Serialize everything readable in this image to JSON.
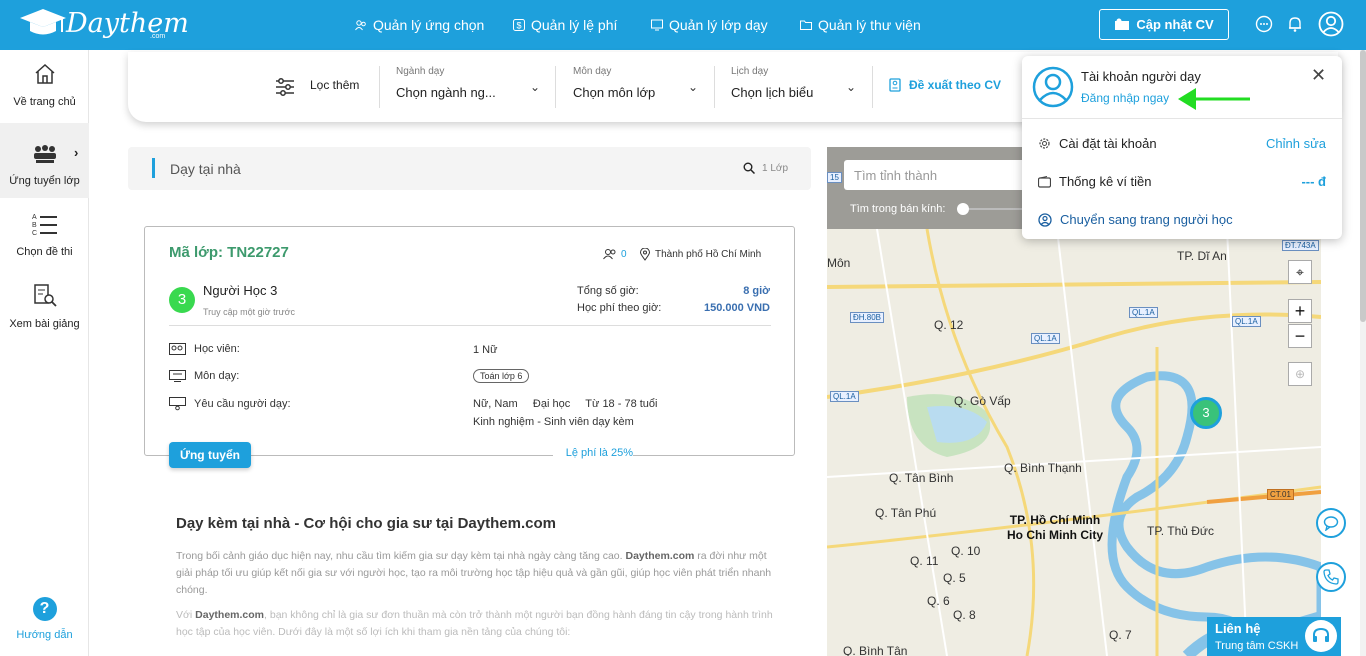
{
  "brand": {
    "name": "Daythem",
    "suffix": ".com"
  },
  "nav": {
    "items": [
      {
        "label": "Quản lý ứng chọn",
        "icon": "users-icon"
      },
      {
        "label": "Quản lý lệ phí",
        "icon": "dollar-icon"
      },
      {
        "label": "Quản lý lớp dạy",
        "icon": "class-icon"
      },
      {
        "label": "Quản lý thư viện",
        "icon": "folder-icon"
      }
    ],
    "cv_button": "Cập nhật CV"
  },
  "sidebar": {
    "items": [
      {
        "label": "Về trang chủ",
        "icon": "home-icon"
      },
      {
        "label": "Ứng tuyển lớp",
        "icon": "classroom-icon"
      },
      {
        "label": "Chọn đề thi",
        "icon": "list-icon"
      },
      {
        "label": "Xem bài giảng",
        "icon": "document-search-icon"
      }
    ],
    "help": {
      "label": "Hướng dẫn",
      "icon": "?"
    }
  },
  "filter": {
    "more_label": "Lọc thêm",
    "major": {
      "label": "Ngành dạy",
      "value": "Chọn ngành ng..."
    },
    "subject": {
      "label": "Môn dạy",
      "value": "Chọn môn lớp"
    },
    "schedule": {
      "label": "Lịch dạy",
      "value": "Chọn lịch biểu"
    },
    "suggest": "Đề xuất theo CV"
  },
  "listing": {
    "title": "Dạy tại nhà",
    "count": "1 Lớp"
  },
  "card": {
    "code": "Mã lớp: TN22727",
    "applicants": "0",
    "city": "Thành phố Hồ Chí Minh",
    "learner_initial": "3",
    "learner_name": "Người Học 3",
    "learner_sub": "Truy cập một giờ trước",
    "total_hours_label": "Tổng số giờ:",
    "total_hours": "8 giờ",
    "fee_label": "Học phí theo giờ:",
    "fee": "150.000 VND",
    "rows": [
      {
        "label": "Học viên:",
        "value": "1 Nữ"
      },
      {
        "label": "Môn dạy:",
        "value": "Toán lớp 6"
      },
      {
        "label": "Yêu cầu người dạy:",
        "value": "Nữ, Nam     Đại học     Từ 18 - 78 tuổi",
        "value2": "Kinh nghiệm - Sinh viên dạy kèm"
      }
    ],
    "apply": "Ứng tuyển",
    "commission": "Lệ phí là 25%"
  },
  "article": {
    "title": "Dạy kèm tại nhà - Cơ hội cho gia sư tại Daythem.com",
    "p1a": "Trong bối cảnh giáo dục hiện nay, nhu cầu tìm kiếm gia sư dạy kèm tại nhà ngày càng tăng cao.",
    "p1b": "Daythem.com",
    "p1c": "ra đời như một giải pháp tối ưu giúp kết nối gia sư với người học, tạo ra môi trường học tập hiệu quả và gần gũi, giúp học viên phát triển nhanh chóng.",
    "p2a": "Với",
    "p2b": "Daythem.com",
    "p2c": ", bạn không chỉ là gia sư đơn thuần mà còn trở thành một người bạn đồng hành đáng tin cậy trong hành trình học tập của học viên. Dưới đây là một số lợi ích khi tham gia nền tảng của chúng tôi:"
  },
  "map": {
    "search_placeholder": "Tìm tỉnh thành",
    "radius_label": "Tìm trong bán kính:",
    "labels": [
      "Q. 12",
      "Q. Gò Vấp",
      "Q. Bình Thạnh",
      "Q. Tân Bình",
      "Q. Tân Phú",
      "Q. 10",
      "Q. 11",
      "Q. 5",
      "Q. 6",
      "Q. 8",
      "Q. Bình Tân",
      "Q. 7",
      "TP. Dĩ An",
      "TP. Thủ Đức",
      "Môn"
    ],
    "city_label": "TP. Hồ Chí Minh",
    "city_label_en": "Ho Chi Minh City",
    "cluster": "3",
    "roads": [
      "QL.1A",
      "QL.1A",
      "QL.1A",
      "ĐH.80B",
      "QL.1A",
      "ĐT.743A",
      "CT.01",
      "15"
    ]
  },
  "popup": {
    "title": "Tài khoản người dạy",
    "login": "Đăng nhập ngay",
    "settings": "Cài đặt tài khoản",
    "settings_action": "Chỉnh sửa",
    "wallet": "Thống kê ví tiền",
    "wallet_value": "--- đ",
    "switch": "Chuyển sang trang người học"
  },
  "contact": {
    "title": "Liên hệ",
    "subtitle": "Trung tâm CSKH"
  },
  "colors": {
    "primary": "#1ea0dc",
    "green": "#3d9a6d",
    "arrow": "#22dd22"
  }
}
